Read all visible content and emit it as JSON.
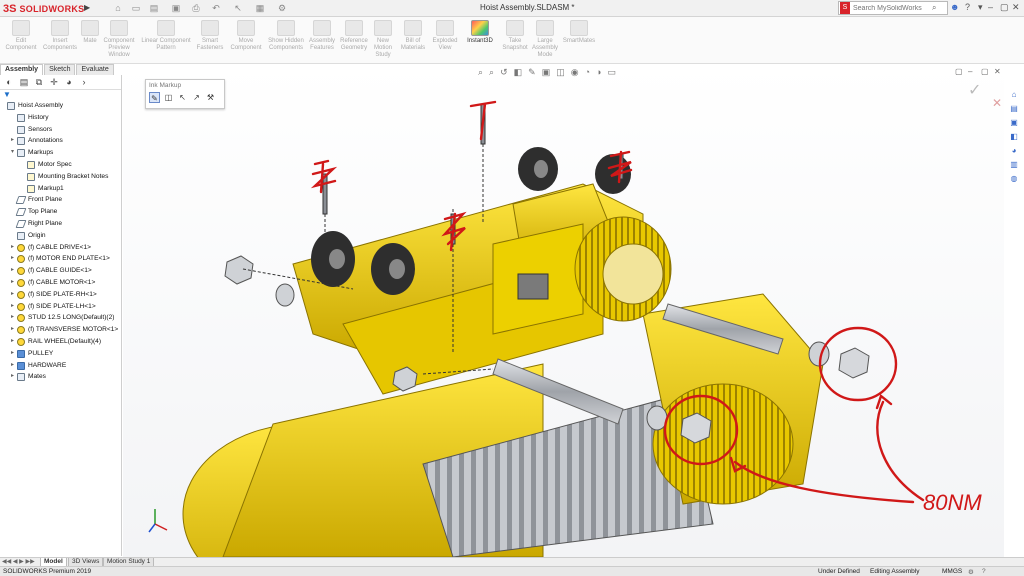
{
  "app": {
    "logo_text": "SOLIDWORKS",
    "logo_icon": "ds-logo-icon"
  },
  "title_bar": {
    "document_title": "Hoist Assembly.SLDASM *",
    "search_placeholder": "Search MySolidWorks",
    "icons": [
      "home-icon",
      "new-icon",
      "open-icon",
      "save-icon",
      "print-icon",
      "undo-icon",
      "select-icon",
      "rebuild-icon",
      "options-icon",
      "user-icon",
      "help-icon",
      "minimize-icon",
      "restore-icon",
      "close-icon"
    ]
  },
  "ribbon": {
    "buttons": [
      {
        "label": "Edit Component",
        "active": false
      },
      {
        "label": "Insert Components",
        "active": false
      },
      {
        "label": "Mate",
        "active": false
      },
      {
        "label": "Component Preview Window",
        "active": false
      },
      {
        "label": "Linear Component Pattern",
        "active": false
      },
      {
        "label": "Smart Fasteners",
        "active": false
      },
      {
        "label": "Move Component",
        "active": false
      },
      {
        "label": "Show Hidden Components",
        "active": false
      },
      {
        "label": "Assembly Features",
        "active": false
      },
      {
        "label": "Reference Geometry",
        "active": false
      },
      {
        "label": "New Motion Study",
        "active": false
      },
      {
        "label": "Bill of Materials",
        "active": false
      },
      {
        "label": "Exploded View",
        "active": false
      },
      {
        "label": "Instant3D",
        "active": true
      },
      {
        "label": "Take Snapshot",
        "active": false
      },
      {
        "label": "Large Assembly Mode",
        "active": false
      },
      {
        "label": "SmartMates",
        "active": false
      }
    ]
  },
  "command_tabs": [
    "Assembly",
    "Sketch",
    "Evaluate"
  ],
  "ink_markup": {
    "title": "Ink Markup",
    "tools": [
      "pen-icon",
      "eraser-icon",
      "select-arrow-icon",
      "lasso-icon",
      "pen-settings-icon"
    ]
  },
  "feature_tree": {
    "items": [
      {
        "label": "Hoist Assembly",
        "level": 0,
        "icon": "assembly-icon",
        "expander": ""
      },
      {
        "label": "History",
        "level": 1,
        "icon": "history-icon",
        "expander": ""
      },
      {
        "label": "Sensors",
        "level": 1,
        "icon": "sensor-icon",
        "expander": ""
      },
      {
        "label": "Annotations",
        "level": 1,
        "icon": "annotation-icon",
        "expander": "▸"
      },
      {
        "label": "Markups",
        "level": 1,
        "icon": "markup-icon",
        "expander": "▾"
      },
      {
        "label": "Motor Spec",
        "level": 2,
        "icon": "note-icon",
        "expander": ""
      },
      {
        "label": "Mounting Bracket Notes",
        "level": 2,
        "icon": "note-icon",
        "expander": ""
      },
      {
        "label": "Markup1",
        "level": 2,
        "icon": "note-icon",
        "expander": ""
      },
      {
        "label": "Front Plane",
        "level": 1,
        "icon": "plane-icon",
        "expander": ""
      },
      {
        "label": "Top Plane",
        "level": 1,
        "icon": "plane-icon",
        "expander": ""
      },
      {
        "label": "Right Plane",
        "level": 1,
        "icon": "plane-icon",
        "expander": ""
      },
      {
        "label": "Origin",
        "level": 1,
        "icon": "origin-icon",
        "expander": ""
      },
      {
        "label": "(f) CABLE DRIVE<1>",
        "level": 1,
        "icon": "part-icon",
        "expander": "▸"
      },
      {
        "label": "(f) MOTOR END PLATE<1>",
        "level": 1,
        "icon": "part-icon",
        "expander": "▸"
      },
      {
        "label": "(f) CABLE GUIDE<1>",
        "level": 1,
        "icon": "part-icon",
        "expander": "▸"
      },
      {
        "label": "(f) CABLE MOTOR<1>",
        "level": 1,
        "icon": "part-icon",
        "expander": "▸"
      },
      {
        "label": "(f) SIDE PLATE-RH<1>",
        "level": 1,
        "icon": "part-icon",
        "expander": "▸"
      },
      {
        "label": "(f) SIDE PLATE-LH<1>",
        "level": 1,
        "icon": "part-icon",
        "expander": "▸"
      },
      {
        "label": "STUD 12.5 LONG(Default)(2)",
        "level": 1,
        "icon": "part-icon",
        "expander": "▸"
      },
      {
        "label": "(f) TRANSVERSE MOTOR<1>",
        "level": 1,
        "icon": "part-icon",
        "expander": "▸"
      },
      {
        "label": "RAIL WHEEL(Default)(4)",
        "level": 1,
        "icon": "part-icon",
        "expander": "▸"
      },
      {
        "label": "PULLEY",
        "level": 1,
        "icon": "folder-icon",
        "expander": "▸"
      },
      {
        "label": "HARDWARE",
        "level": 1,
        "icon": "folder-icon",
        "expander": "▸"
      },
      {
        "label": "Mates",
        "level": 1,
        "icon": "mates-icon",
        "expander": "▸"
      }
    ]
  },
  "canvas": {
    "markup_text": "80NM",
    "colors": {
      "body": "#f5d800",
      "shade": "#c9a800",
      "ink": "#d01818",
      "steel": "#b8bcc2"
    }
  },
  "bottom_tabs": [
    "Model",
    "3D Views",
    "Motion Study 1"
  ],
  "status_bar": {
    "product": "SOLIDWORKS Premium 2019",
    "state1": "Under Defined",
    "state2": "Editing Assembly",
    "units": "MMGS"
  }
}
